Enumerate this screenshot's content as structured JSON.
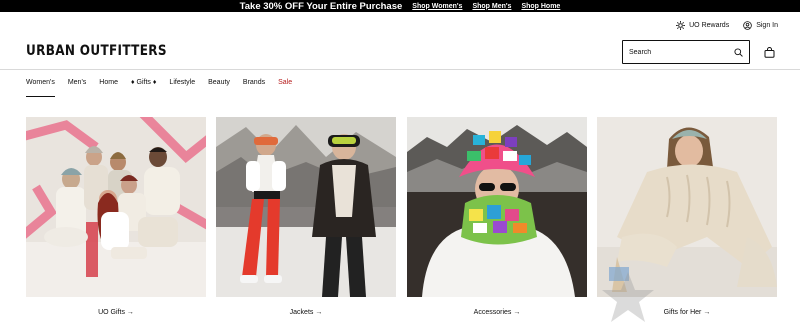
{
  "promo": {
    "headline": "Take 30% OFF Your Entire Purchase",
    "links": [
      "Shop Women's",
      "Shop Men's",
      "Shop Home"
    ]
  },
  "utility": {
    "rewards": "UO Rewards",
    "signin": "Sign In"
  },
  "brand": {
    "logo": "URBAN OUTFITTERS"
  },
  "search": {
    "placeholder": "Search"
  },
  "nav": {
    "items": [
      "Women's",
      "Men's",
      "Home",
      "♦ Gifts ♦",
      "Lifestyle",
      "Beauty",
      "Brands",
      "Sale"
    ],
    "active": "Women's"
  },
  "tiles": [
    {
      "caption": "UO Gifts →",
      "icon": "group-photo"
    },
    {
      "caption": "Jackets →",
      "icon": "jackets-photo"
    },
    {
      "caption": "Accessories →",
      "icon": "accessories-photo"
    },
    {
      "caption": "Gifts for Her →",
      "icon": "sweater-photo"
    }
  ],
  "colors": {
    "promo_bg": "#000000",
    "sale": "#b51b1b",
    "accent_pink": "#e8758f"
  }
}
